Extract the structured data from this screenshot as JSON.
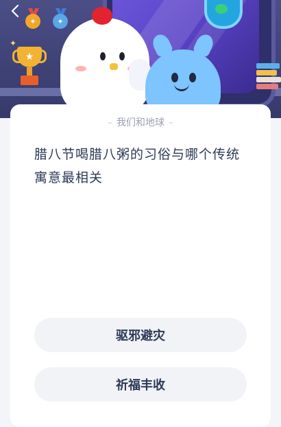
{
  "header": {
    "back_icon": "chevron-left-icon",
    "medals": [
      {
        "name": "gold-medal-icon",
        "color": "#f2a72b"
      },
      {
        "name": "silver-medal-icon",
        "color": "#5aa6e6"
      }
    ],
    "trophy_icon": "trophy-icon"
  },
  "quiz": {
    "category": "我们和地球",
    "question": "腊八节喝腊八粥的习俗与哪个传统寓意最相关",
    "options": [
      {
        "label": "驱邪避灾"
      },
      {
        "label": "祈福丰收"
      }
    ]
  },
  "colors": {
    "header_bg": "#3e4276",
    "card_bg": "#ffffff",
    "option_bg": "#f2f3f6",
    "text_primary": "#2c3a55",
    "text_secondary": "#9aa1b3"
  }
}
